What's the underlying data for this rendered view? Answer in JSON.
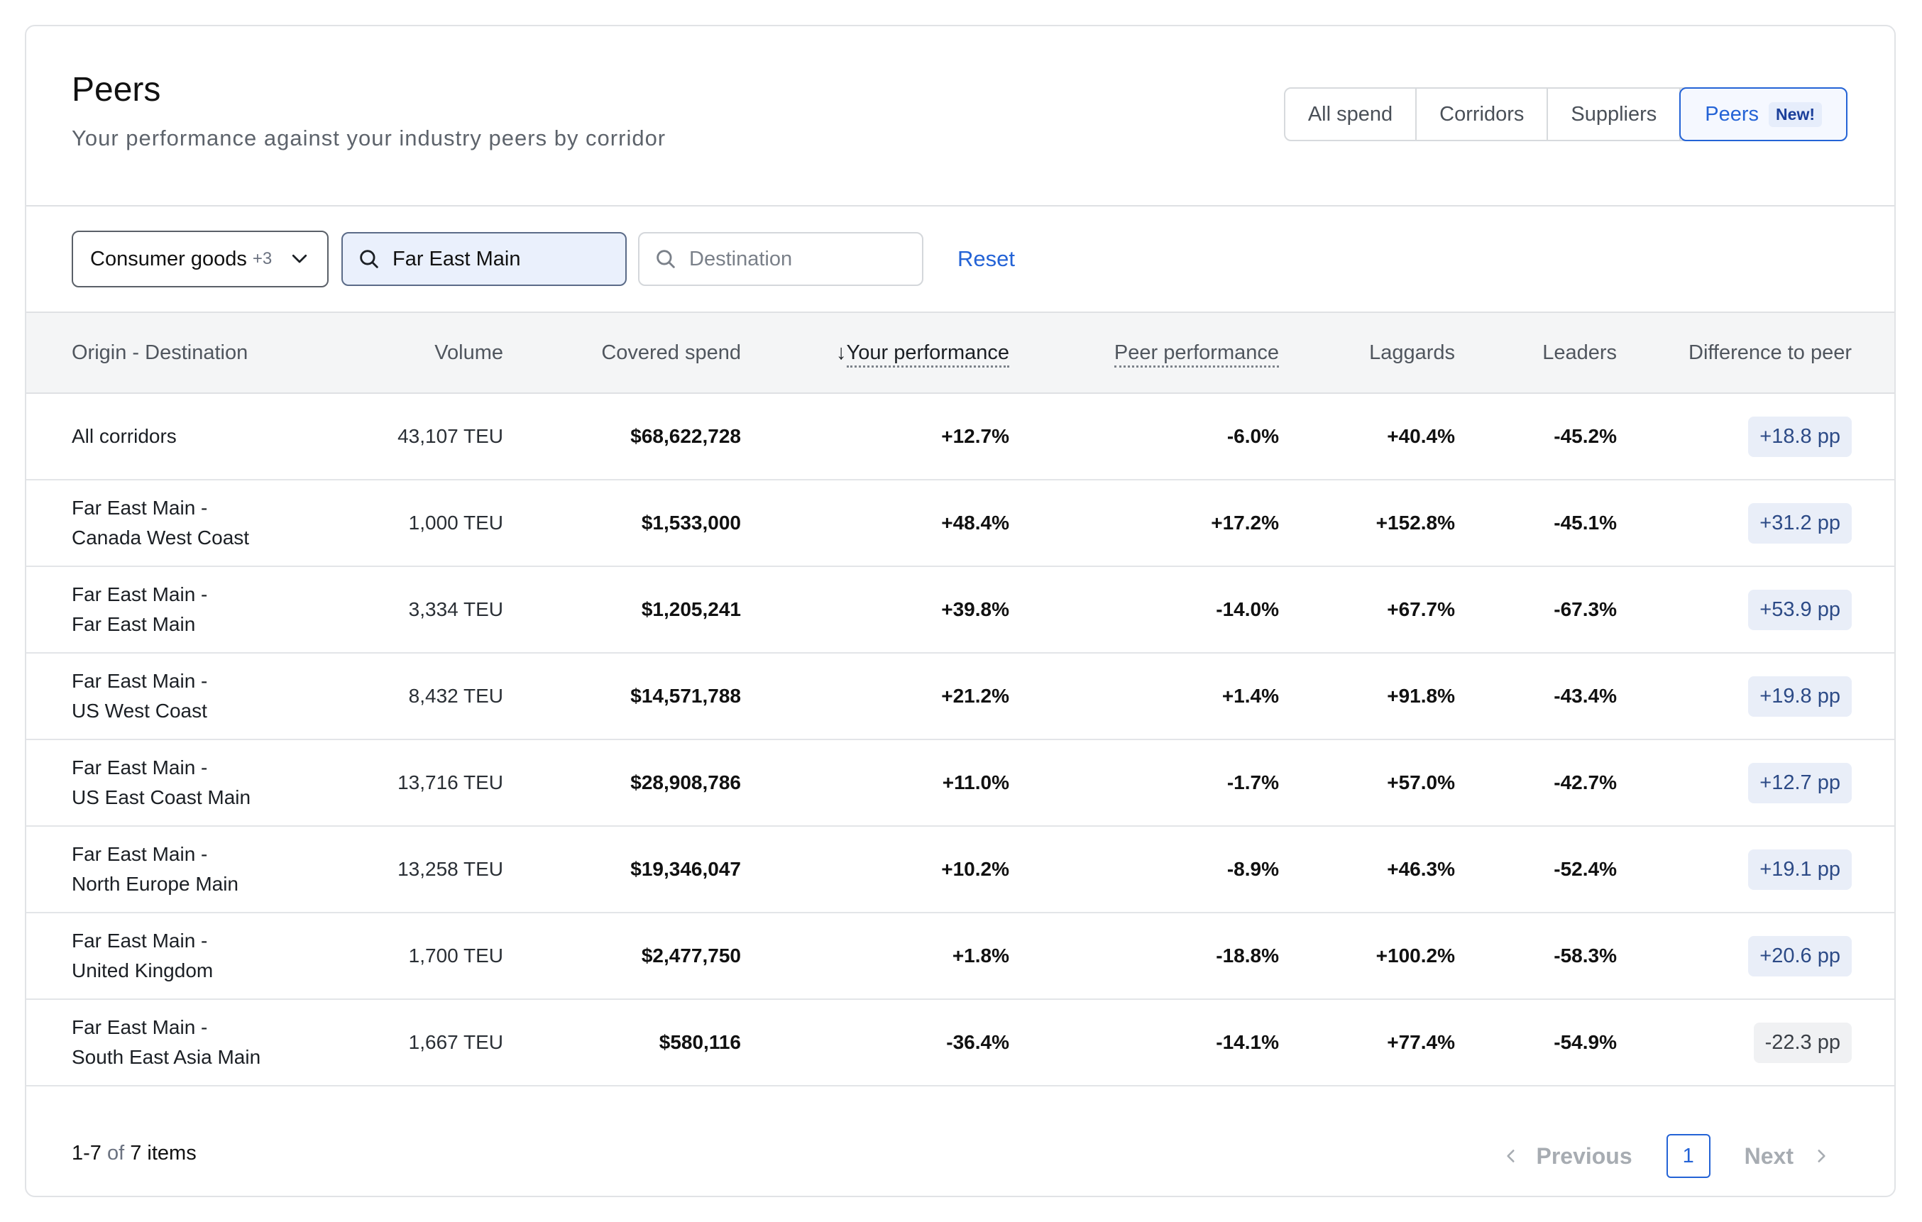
{
  "header": {
    "title": "Peers",
    "subtitle": "Your performance against your industry peers by corridor",
    "tabs": [
      {
        "label": "All spend"
      },
      {
        "label": "Corridors"
      },
      {
        "label": "Suppliers"
      },
      {
        "label": "Peers",
        "badge": "New!",
        "active": true
      }
    ]
  },
  "filters": {
    "industry": {
      "value": "Consumer goods",
      "count": "+3"
    },
    "origin": {
      "value": "Far East Main"
    },
    "destination": {
      "placeholder": "Destination"
    },
    "reset_label": "Reset"
  },
  "table": {
    "columns": [
      "Origin - Destination",
      "Volume",
      "Covered spend",
      "Your performance",
      "Peer performance",
      "Laggards",
      "Leaders",
      "Difference to peer"
    ],
    "sorted_column": "Your performance",
    "rows": [
      {
        "line1": "All corridors",
        "line2": "",
        "volume": "43,107 TEU",
        "spend": "$68,622,728",
        "yours": "+12.7%",
        "peer": "-6.0%",
        "laggards": "+40.4%",
        "leaders": "-45.2%",
        "diff": "+18.8 pp"
      },
      {
        "line1": "Far East Main -",
        "line2": "Canada West Coast",
        "volume": "1,000 TEU",
        "spend": "$1,533,000",
        "yours": "+48.4%",
        "peer": "+17.2%",
        "laggards": "+152.8%",
        "leaders": "-45.1%",
        "diff": "+31.2 pp"
      },
      {
        "line1": "Far East Main -",
        "line2": "Far East Main",
        "volume": "3,334 TEU",
        "spend": "$1,205,241",
        "yours": "+39.8%",
        "peer": "-14.0%",
        "laggards": "+67.7%",
        "leaders": "-67.3%",
        "diff": "+53.9 pp"
      },
      {
        "line1": "Far East Main -",
        "line2": "US West Coast",
        "volume": "8,432 TEU",
        "spend": "$14,571,788",
        "yours": "+21.2%",
        "peer": "+1.4%",
        "laggards": "+91.8%",
        "leaders": "-43.4%",
        "diff": "+19.8 pp"
      },
      {
        "line1": "Far East Main -",
        "line2": "US East Coast Main",
        "volume": "13,716 TEU",
        "spend": "$28,908,786",
        "yours": "+11.0%",
        "peer": "-1.7%",
        "laggards": "+57.0%",
        "leaders": "-42.7%",
        "diff": "+12.7 pp"
      },
      {
        "line1": "Far East Main -",
        "line2": "North Europe Main",
        "volume": "13,258 TEU",
        "spend": "$19,346,047",
        "yours": "+10.2%",
        "peer": "-8.9%",
        "laggards": "+46.3%",
        "leaders": "-52.4%",
        "diff": "+19.1 pp"
      },
      {
        "line1": "Far East Main -",
        "line2": "United Kingdom",
        "volume": "1,700 TEU",
        "spend": "$2,477,750",
        "yours": "+1.8%",
        "peer": "-18.8%",
        "laggards": "+100.2%",
        "leaders": "-58.3%",
        "diff": "+20.6 pp"
      },
      {
        "line1": "Far East Main -",
        "line2": "South East Asia Main",
        "volume": "1,667 TEU",
        "spend": "$580,116",
        "yours": "-36.4%",
        "peer": "-14.1%",
        "laggards": "+77.4%",
        "leaders": "-54.9%",
        "diff": "-22.3 pp"
      }
    ]
  },
  "footer": {
    "range": "1-7",
    "of": "of",
    "total": "7 items",
    "prev_label": "Previous",
    "next_label": "Next",
    "current_page": "1"
  },
  "colors": {
    "accent": "#2463d6",
    "pill_positive_bg": "#e9eef8",
    "pill_negative_bg": "#f0f1f3"
  }
}
